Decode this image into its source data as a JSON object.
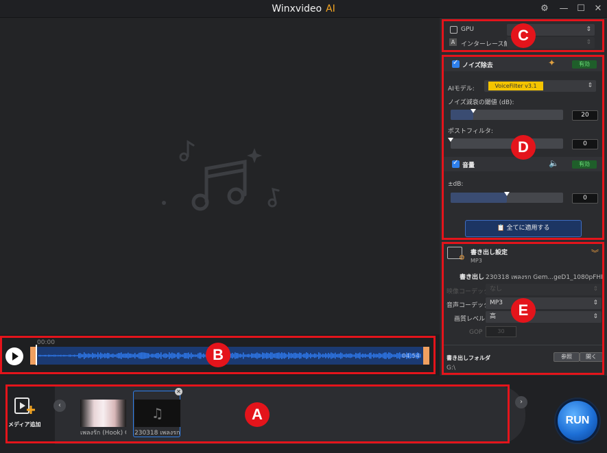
{
  "app": {
    "title": "Winxvideo",
    "title_suffix": "AI"
  },
  "timeline": {
    "start_time": "00:00",
    "end_time": "04:54"
  },
  "device": {
    "gpu_label": "GPU",
    "deinterlace_label": "インターレース解除"
  },
  "noise": {
    "title": "ノイズ除去",
    "status": "有効",
    "model_label": "AIモデル:",
    "model_value": "VoiceFilter v3.1",
    "threshold_label": "ノイズ減衰の閾値 (dB):",
    "threshold_value": "20",
    "threshold_level": 0.2,
    "postfilter_label": "ポストフィルタ:",
    "postfilter_value": "0",
    "postfilter_level": 0.0
  },
  "volume": {
    "title": "音量",
    "status": "有効",
    "db_label": "±dB:",
    "db_value": "0",
    "db_level": 0.5
  },
  "apply_all_label": "全てに適用する",
  "export": {
    "title": "書き出し設定",
    "format": "MP3",
    "output_label": "書き出し",
    "output_filename": "230318 เพลงรก Gem...geD1_1080pFHR.mp3",
    "video_codec_label": "映像コーデック",
    "video_codec_value": "なし",
    "audio_codec_label": "音声コーデック",
    "audio_codec_value": "MP3",
    "quality_label": "画質レベル",
    "quality_value": "高",
    "gop_label": "GOP",
    "gop_value": "30",
    "folder_label": "書き出しフォルダ",
    "browse_label": "参照",
    "open_label": "開く",
    "folder_path": "G:\\"
  },
  "media": {
    "add_label": "メディア追加",
    "items": [
      {
        "caption": "เพลงรัก (Hook) O"
      },
      {
        "caption": "230318 เพลงรก G"
      }
    ]
  },
  "run_label": "RUN",
  "annotations": {
    "a": "A",
    "b": "B",
    "c": "C",
    "d": "D",
    "e": "E"
  },
  "colors": {
    "annotation_red": "#e4141b",
    "accent_blue": "#2f80ed",
    "waveform_blue": "#2f6fd6",
    "model_yellow": "#f5c400",
    "enabled_green": "#6be07a"
  }
}
